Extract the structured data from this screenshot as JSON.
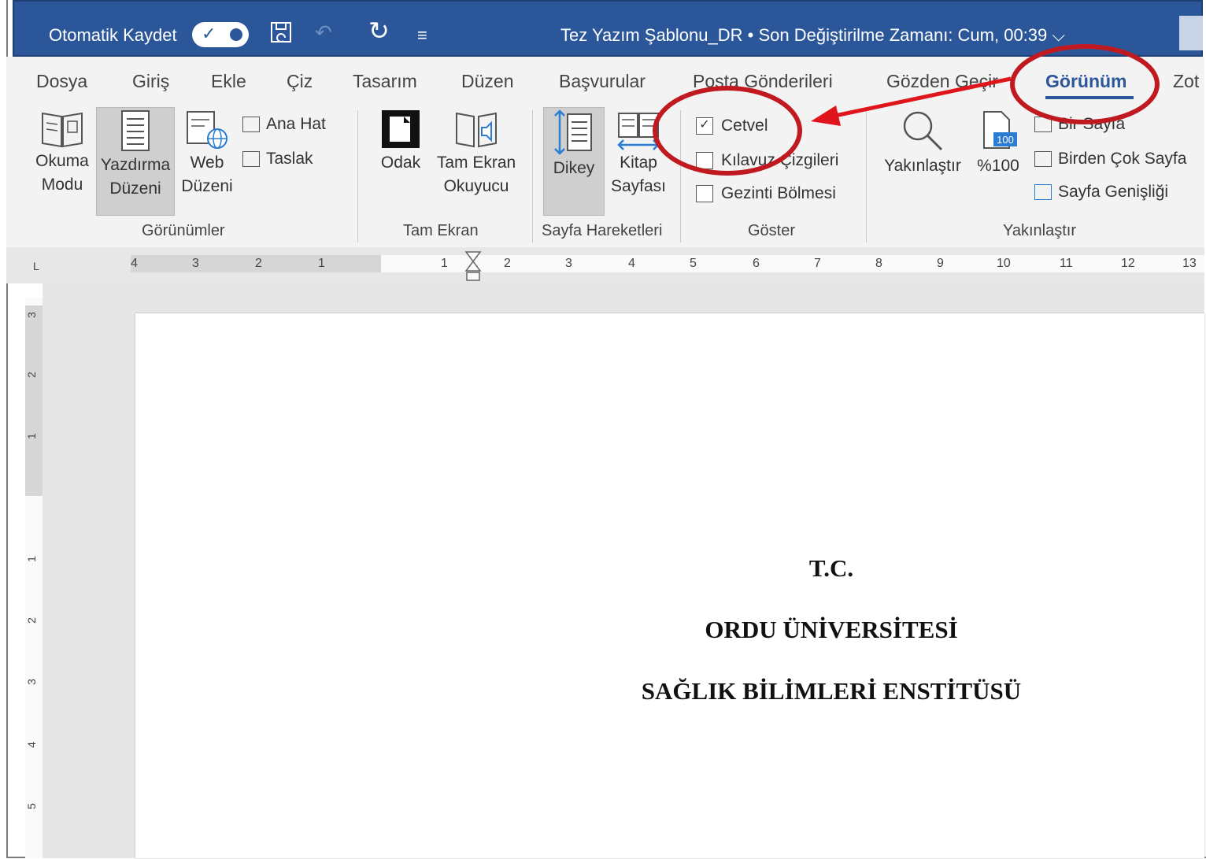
{
  "titlebar": {
    "autosave_label": "Otomatik Kaydet",
    "doc_title": "Tez Yazım Şablonu_DR  •  Son Değiştirilme Zamanı: Cum, 00:39 ⌵",
    "toggle_check": "✓",
    "save_icon": "💾",
    "undo_icon": "↶",
    "redo_icon": "↻",
    "customize_icon": "≡"
  },
  "tabs": [
    "Dosya",
    "Giriş",
    "Ekle",
    "Çiz",
    "Tasarım",
    "Düzen",
    "Başvurular",
    "Posta Gönderileri",
    "Gözden Geçir",
    "Görünüm",
    "Zot"
  ],
  "views": {
    "reading_mode": [
      "Okuma",
      "Modu"
    ],
    "print_layout": [
      "Yazdırma",
      "Düzeni"
    ],
    "web_layout": [
      "Web",
      "Düzeni"
    ],
    "outline": "Ana Hat",
    "draft": "Taslak",
    "group_label": "Görünümler"
  },
  "immersive": {
    "focus": "Odak",
    "reader": [
      "Tam Ekran",
      "Okuyucu"
    ],
    "group_label": "Tam Ekran"
  },
  "page_movement": {
    "vertical": "Dikey",
    "side_by_side": [
      "Kitap",
      "Sayfası"
    ],
    "group_label": "Sayfa Hareketleri"
  },
  "show": {
    "ruler": "Cetvel",
    "gridlines": "Kılavuz Çizgileri",
    "nav_pane": "Gezinti Bölmesi",
    "check_mark": "✓",
    "group_label": "Göster"
  },
  "zoom": {
    "zoom": "Yakınlaştır",
    "hundred": "%100",
    "hundred_badge": "100",
    "one_page": "Bir Sayfa",
    "multiple_pages": "Birden Çok Sayfa",
    "page_width": "Sayfa Genişliği",
    "group_label": "Yakınlaştır"
  },
  "ruler": {
    "corner": "L",
    "left_labels": [
      "4",
      "3",
      "2",
      "1"
    ],
    "right_labels": [
      "1",
      "2",
      "3",
      "4",
      "5",
      "6",
      "7",
      "8",
      "9",
      "10",
      "11",
      "12",
      "13"
    ],
    "vertical_labels": [
      "3",
      "2",
      "1",
      "1",
      "2",
      "3",
      "4",
      "5"
    ]
  },
  "document": {
    "lines": [
      "T.C.",
      "ORDU ÜNİVERSİTESİ",
      "SAĞLIK BİLİMLERİ ENSTİTÜSÜ"
    ]
  },
  "colors": {
    "title_bar": "#2b579a",
    "annotation_red": "#c0191f"
  }
}
